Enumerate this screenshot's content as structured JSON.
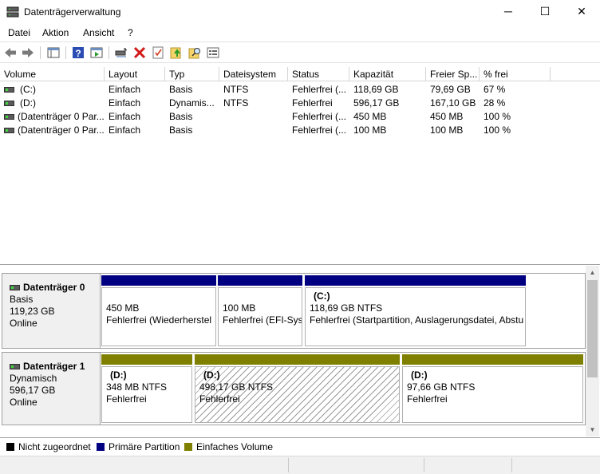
{
  "window": {
    "title": "Datenträgerverwaltung",
    "minimize": "─",
    "maximize": "☐",
    "close": "✕"
  },
  "menu": [
    "Datei",
    "Aktion",
    "Ansicht",
    "?"
  ],
  "toolbar": {
    "icons": [
      "back-icon",
      "forward-icon",
      "console-tree-icon",
      "help-icon",
      "action-pane-icon",
      "connect-drive-icon",
      "delete-icon",
      "check-icon",
      "folder-up-icon",
      "search-folder-icon",
      "properties-icon"
    ]
  },
  "volume_list": {
    "columns": [
      "Volume",
      "Layout",
      "Typ",
      "Dateisystem",
      "Status",
      "Kapazität",
      "Freier Sp...",
      "% frei"
    ],
    "rows": [
      {
        "volume": "(C:)",
        "layout": "Einfach",
        "typ": "Basis",
        "fs": "NTFS",
        "status": "Fehlerfrei (...",
        "kapazitaet": "118,69 GB",
        "frei": "79,69 GB",
        "prozent": "67 %"
      },
      {
        "volume": "(D:)",
        "layout": "Einfach",
        "typ": "Dynamis...",
        "fs": "NTFS",
        "status": "Fehlerfrei",
        "kapazitaet": "596,17 GB",
        "frei": "167,10 GB",
        "prozent": "28 %"
      },
      {
        "volume": "(Datenträger 0 Par...",
        "layout": "Einfach",
        "typ": "Basis",
        "fs": "",
        "status": "Fehlerfrei (...",
        "kapazitaet": "450 MB",
        "frei": "450 MB",
        "prozent": "100 %"
      },
      {
        "volume": "(Datenträger 0 Par...",
        "layout": "Einfach",
        "typ": "Basis",
        "fs": "",
        "status": "Fehlerfrei (...",
        "kapazitaet": "100 MB",
        "frei": "100 MB",
        "prozent": "100 %"
      }
    ]
  },
  "disks": [
    {
      "name": "Datenträger 0",
      "type": "Basis",
      "size": "119,23 GB",
      "state": "Online",
      "partitions": [
        {
          "label": "",
          "size": "450 MB",
          "status": "Fehlerfrei (Wiederherstel"
        },
        {
          "label": "",
          "size": "100 MB",
          "status": "Fehlerfrei (EFI-Sys"
        },
        {
          "label": "(C:)",
          "size": "118,69 GB NTFS",
          "status": "Fehlerfrei (Startpartition, Auslagerungsdatei, Abstu"
        }
      ]
    },
    {
      "name": "Datenträger 1",
      "type": "Dynamisch",
      "size": "596,17 GB",
      "state": "Online",
      "partitions": [
        {
          "label": "(D:)",
          "size": "348 MB NTFS",
          "status": "Fehlerfrei"
        },
        {
          "label": "(D:)",
          "size": "498,17 GB NTFS",
          "status": "Fehlerfrei"
        },
        {
          "label": "(D:)",
          "size": "97,66 GB NTFS",
          "status": "Fehlerfrei"
        }
      ]
    }
  ],
  "legend": [
    {
      "label": "Nicht zugeordnet",
      "color": "#000000"
    },
    {
      "label": "Primäre Partition",
      "color": "#000080"
    },
    {
      "label": "Einfaches Volume",
      "color": "#808000"
    }
  ],
  "colors": {
    "primary": "#000080",
    "simple": "#808000"
  }
}
